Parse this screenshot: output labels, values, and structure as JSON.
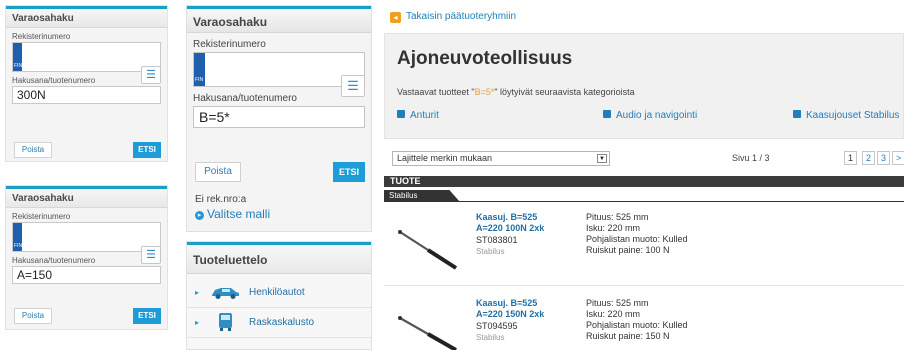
{
  "widgets": [
    {
      "title": "Varaosahaku",
      "reg_label": "Rekisterinumero",
      "search_label": "Hakusana/tuotenumero",
      "search_value": "300N",
      "clear_label": "Poista",
      "search_button": "ETSI"
    },
    {
      "title": "Varaosahaku",
      "reg_label": "Rekisterinumero",
      "search_label": "Hakusana/tuotenumero",
      "search_value": "A=150",
      "clear_label": "Poista",
      "search_button": "ETSI"
    }
  ],
  "plate_country": "FIN",
  "middle": {
    "title": "Varaosahaku",
    "reg_label": "Rekisterinumero",
    "search_label": "Hakusana/tuotenumero",
    "search_value": "B=5*",
    "clear_label": "Poista",
    "search_button": "ETSI",
    "no_reg_text": "Ei rek.nro:a",
    "choose_model": "Valitse malli"
  },
  "catalog": {
    "title": "Tuoteluettelo",
    "items": [
      {
        "label": "Henkilöautot",
        "icon": "car-icon"
      },
      {
        "label": "Raskaskalusto",
        "icon": "bus-icon"
      }
    ]
  },
  "back_link": "Takaisin päätuoteryhmiin",
  "category": {
    "title": "Ajoneuvoteollisuus",
    "desc_prefix": "Vastaavat tuotteet \"",
    "desc_term": "B=5*",
    "desc_suffix": "\" löytyivät seuraavista kategorioista",
    "links": [
      "Anturit",
      "Audio ja navigointi",
      "Kaasujouset Stabilus"
    ]
  },
  "sort": {
    "selected": "Lajittele merkin mukaan"
  },
  "pagination": {
    "label": "Sivu 1 / 3",
    "pages": [
      "1",
      "2",
      "3",
      ">"
    ]
  },
  "table_header": "TUOTE",
  "brand_tab": "Stabilus",
  "products": [
    {
      "name_line1": "Kaasuj. B=525",
      "name_line2": "A=220 100N 2xk",
      "code": "ST083801",
      "brand": "Stabilus",
      "specs": [
        "Pituus: 525 mm",
        "Isku: 220 mm",
        "Pohjalistan muoto: Kulled",
        "Ruiskut paine: 100 N"
      ]
    },
    {
      "name_line1": "Kaasuj. B=525",
      "name_line2": "A=220 150N 2xk",
      "code": "ST094595",
      "brand": "Stabilus",
      "specs": [
        "Pituus: 525 mm",
        "Isku: 220 mm",
        "Pohjalistan muoto: Kulled",
        "Ruiskut paine: 150 N"
      ]
    }
  ],
  "colors": {
    "accent": "#1aa0c4",
    "button": "#1c9dd7",
    "link": "#1f7fb9",
    "highlight": "#e8a030"
  }
}
